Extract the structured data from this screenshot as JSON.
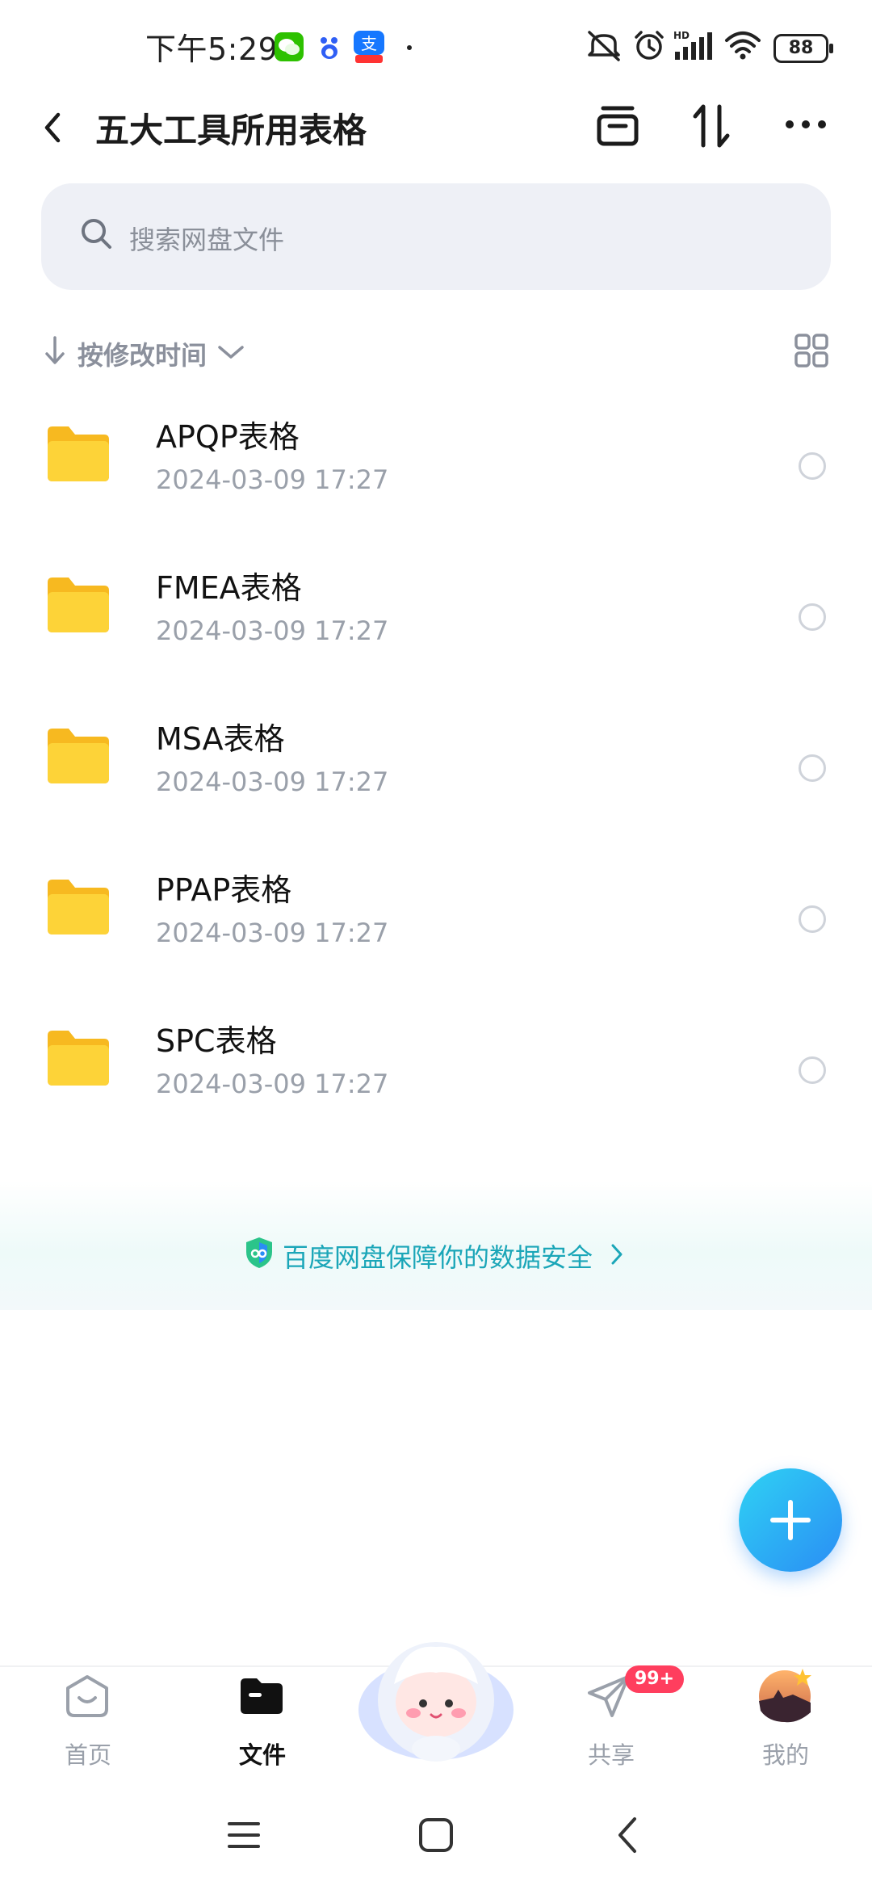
{
  "status_bar": {
    "time": "下午5:29",
    "battery": "88",
    "icons": [
      "wechat-icon",
      "baidu-icon",
      "alipay-icon",
      "mute-icon",
      "alarm-icon",
      "signal-icon",
      "wifi-icon",
      "battery-icon"
    ]
  },
  "header": {
    "title": "五大工具所用表格",
    "back_icon": "back-arrow-icon",
    "actions": [
      "archive-icon",
      "sort-swap-icon",
      "more-icon"
    ]
  },
  "search": {
    "placeholder": "搜索网盘文件"
  },
  "sort": {
    "label": "按修改时间"
  },
  "files": [
    {
      "name": "APQP表格",
      "date": "2024-03-09  17:27"
    },
    {
      "name": "FMEA表格",
      "date": "2024-03-09  17:27"
    },
    {
      "name": "MSA表格",
      "date": "2024-03-09  17:27"
    },
    {
      "name": "PPAP表格",
      "date": "2024-03-09  17:27"
    },
    {
      "name": "SPC表格",
      "date": "2024-03-09  17:27"
    }
  ],
  "banner": {
    "text": "百度网盘保障你的数据安全"
  },
  "tabs": [
    {
      "label": "首页",
      "icon": "home-icon",
      "active": false
    },
    {
      "label": "文件",
      "icon": "folder-tab-icon",
      "active": true
    },
    {
      "label": "",
      "icon": "mascot-icon",
      "active": false
    },
    {
      "label": "共享",
      "icon": "share-icon",
      "active": false,
      "badge": "99+"
    },
    {
      "label": "我的",
      "icon": "avatar-icon",
      "active": false
    }
  ],
  "colors": {
    "folder": "#fcc92e",
    "accent": "#2a8df5",
    "banner_text": "#1ba6b8",
    "badge": "#ff3e5e"
  }
}
